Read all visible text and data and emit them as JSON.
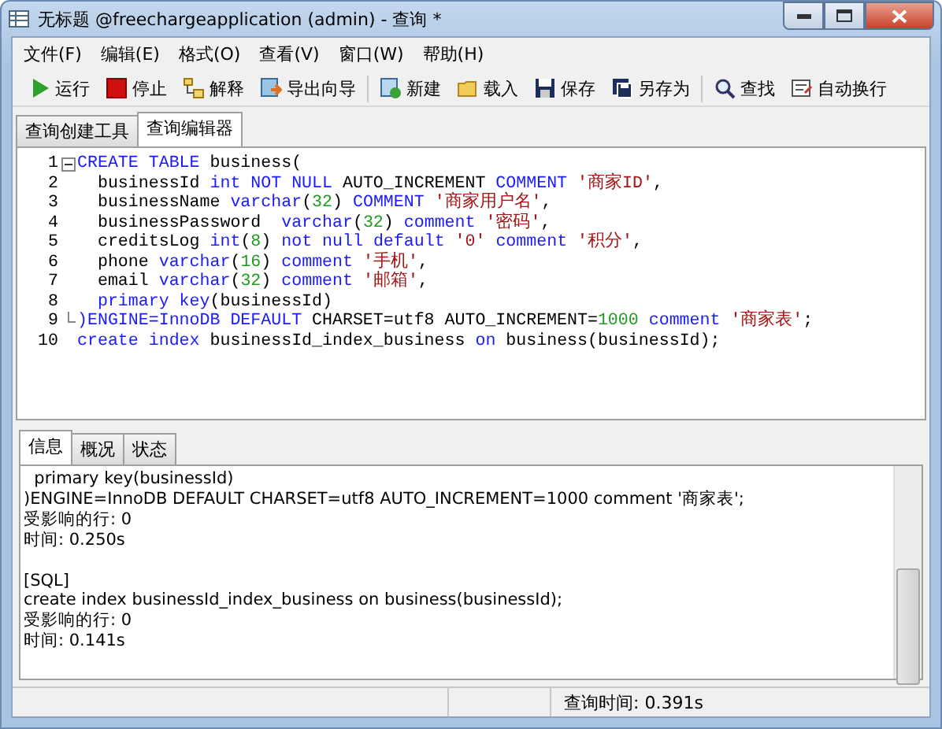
{
  "window": {
    "title": "无标题 @freechargeapplication (admin) - 查询 *"
  },
  "menu": [
    "文件(F)",
    "编辑(E)",
    "格式(O)",
    "查看(V)",
    "窗口(W)",
    "帮助(H)"
  ],
  "toolbar": [
    [
      "运行",
      "停止",
      "解释",
      "导出向导"
    ],
    [
      "新建",
      "载入",
      "保存",
      "另存为"
    ],
    [
      "查找",
      "自动换行"
    ]
  ],
  "tabs": [
    {
      "label": "查询创建工具",
      "selected": false
    },
    {
      "label": "查询编辑器",
      "selected": true
    }
  ],
  "editor": {
    "lines": [
      {
        "number": "1",
        "collapsible": true,
        "tokens": [
          {
            "kind": "kw",
            "text": "CREATE TABLE"
          },
          {
            "kind": "plain",
            "text": " business("
          }
        ]
      },
      {
        "number": "2",
        "tokens": [
          {
            "kind": "plain",
            "text": "  businessId "
          },
          {
            "kind": "kw",
            "text": "int NOT NULL"
          },
          {
            "kind": "plain",
            "text": " AUTO_INCREMENT "
          },
          {
            "kind": "kw",
            "text": "COMMENT"
          },
          {
            "kind": "str",
            "text": " '商家ID'"
          },
          {
            "kind": "plain",
            "text": ","
          }
        ]
      },
      {
        "number": "3",
        "tokens": [
          {
            "kind": "plain",
            "text": "  businessName "
          },
          {
            "kind": "kw",
            "text": "varchar"
          },
          {
            "kind": "plain",
            "text": "("
          },
          {
            "kind": "num",
            "text": "32"
          },
          {
            "kind": "plain",
            "text": ") "
          },
          {
            "kind": "kw",
            "text": "COMMENT"
          },
          {
            "kind": "str",
            "text": " '商家用户名'"
          },
          {
            "kind": "plain",
            "text": ","
          }
        ]
      },
      {
        "number": "4",
        "tokens": [
          {
            "kind": "plain",
            "text": "  businessPassword  "
          },
          {
            "kind": "kw",
            "text": "varchar"
          },
          {
            "kind": "plain",
            "text": "("
          },
          {
            "kind": "num",
            "text": "32"
          },
          {
            "kind": "plain",
            "text": ") "
          },
          {
            "kind": "kw",
            "text": "comment"
          },
          {
            "kind": "str",
            "text": " '密码'"
          },
          {
            "kind": "plain",
            "text": ","
          }
        ]
      },
      {
        "number": "5",
        "tokens": [
          {
            "kind": "plain",
            "text": "  creditsLog "
          },
          {
            "kind": "kw",
            "text": "int"
          },
          {
            "kind": "plain",
            "text": "("
          },
          {
            "kind": "num",
            "text": "8"
          },
          {
            "kind": "plain",
            "text": ") "
          },
          {
            "kind": "kw",
            "text": "not null default"
          },
          {
            "kind": "str",
            "text": " '0'"
          },
          {
            "kind": "kw",
            "text": " comment"
          },
          {
            "kind": "str",
            "text": " '积分'"
          },
          {
            "kind": "plain",
            "text": ","
          }
        ]
      },
      {
        "number": "6",
        "tokens": [
          {
            "kind": "plain",
            "text": "  phone "
          },
          {
            "kind": "kw",
            "text": "varchar"
          },
          {
            "kind": "plain",
            "text": "("
          },
          {
            "kind": "num",
            "text": "16"
          },
          {
            "kind": "plain",
            "text": ") "
          },
          {
            "kind": "kw",
            "text": "comment"
          },
          {
            "kind": "str",
            "text": " '手机'"
          },
          {
            "kind": "plain",
            "text": ","
          }
        ]
      },
      {
        "number": "7",
        "tokens": [
          {
            "kind": "plain",
            "text": "  email "
          },
          {
            "kind": "kw",
            "text": "varchar"
          },
          {
            "kind": "plain",
            "text": "("
          },
          {
            "kind": "num",
            "text": "32"
          },
          {
            "kind": "plain",
            "text": ") "
          },
          {
            "kind": "kw",
            "text": "comment"
          },
          {
            "kind": "str",
            "text": " '邮箱'"
          },
          {
            "kind": "plain",
            "text": ","
          }
        ]
      },
      {
        "number": "8",
        "tokens": [
          {
            "kind": "kw",
            "text": "  primary key"
          },
          {
            "kind": "plain",
            "text": "(businessId)"
          }
        ]
      },
      {
        "number": "9",
        "block_end": true,
        "tokens": [
          {
            "kind": "kw",
            "text": ")ENGINE=InnoDB DEFAULT"
          },
          {
            "kind": "plain",
            "text": " CHARSET=utf8 AUTO_INCREMENT="
          },
          {
            "kind": "num",
            "text": "1000"
          },
          {
            "kind": "kw",
            "text": " comment"
          },
          {
            "kind": "str",
            "text": " '商家表'"
          },
          {
            "kind": "plain",
            "text": ";"
          }
        ]
      },
      {
        "number": "10",
        "tokens": [
          {
            "kind": "kw",
            "text": "create index"
          },
          {
            "kind": "plain",
            "text": " businessId_index_business "
          },
          {
            "kind": "kw",
            "text": "on"
          },
          {
            "kind": "plain",
            "text": " business(businessId);"
          }
        ]
      }
    ]
  },
  "result_tabs": [
    {
      "label": "信息",
      "selected": true
    },
    {
      "label": "概况",
      "selected": false
    },
    {
      "label": "状态",
      "selected": false
    }
  ],
  "messages": [
    [
      "  primary key(businessId)",
      ")ENGINE=InnoDB DEFAULT CHARSET=utf8 AUTO_INCREMENT=1000 comment '商家表';",
      "受影响的行: 0",
      "时间: 0.250s"
    ],
    [
      "[SQL]",
      "create index businessId_index_business on business(businessId);",
      "受影响的行: 0",
      "时间: 0.141s"
    ]
  ],
  "status_bar": {
    "query_time": "查询时间: 0.391s"
  }
}
